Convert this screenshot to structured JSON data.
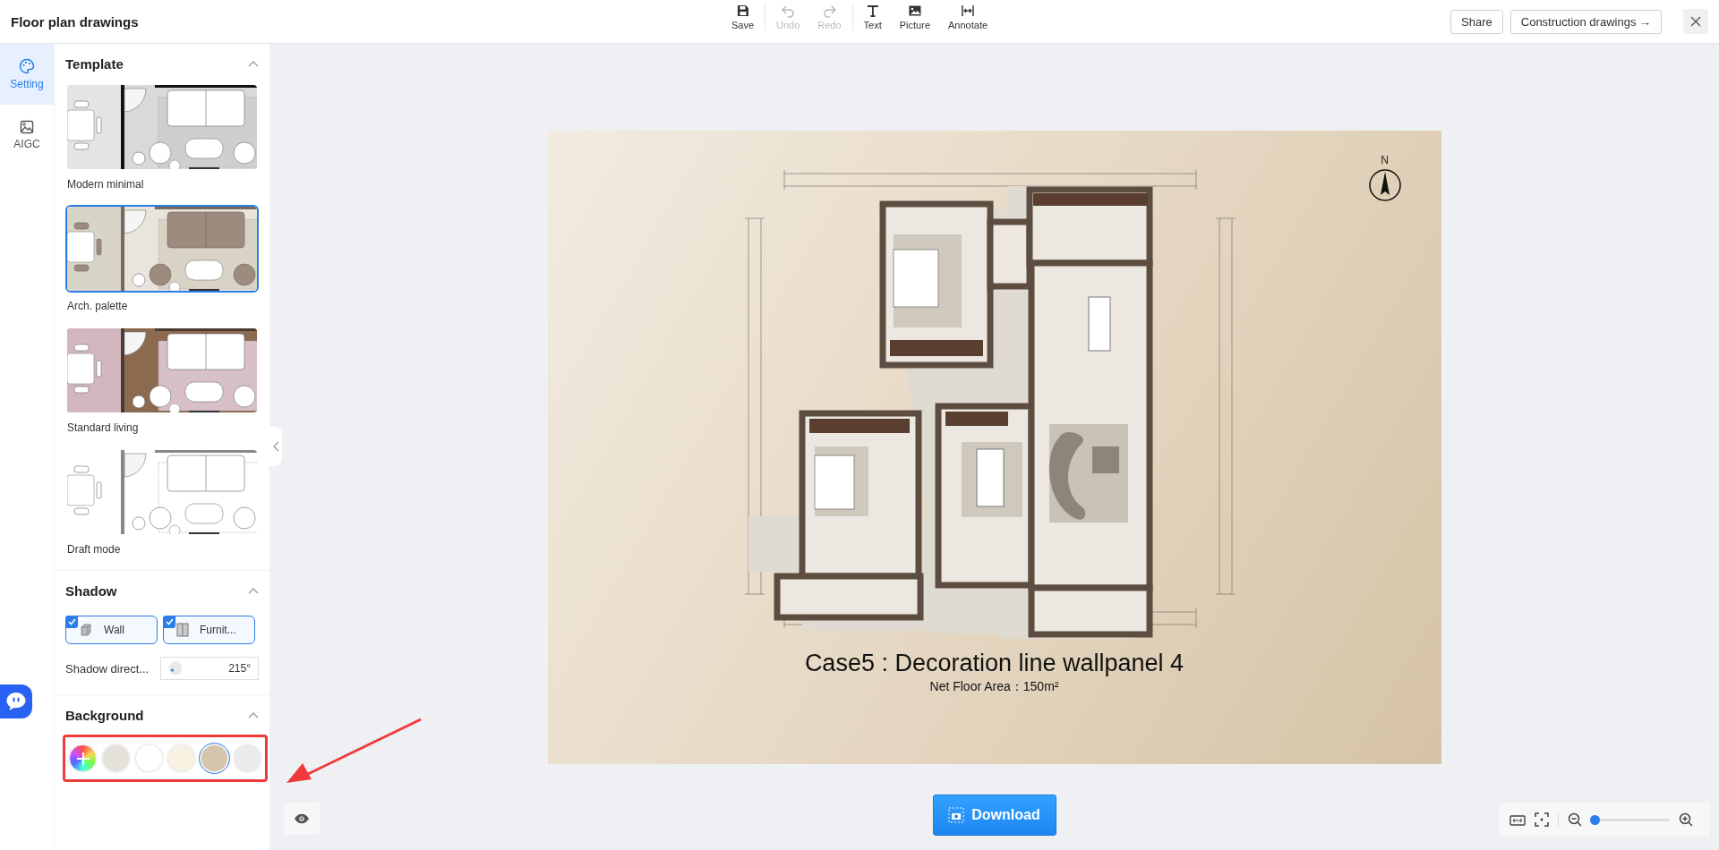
{
  "window": {
    "title": "Floor plan drawings"
  },
  "toolbar": [
    {
      "label": "Save",
      "kind": "save",
      "disabled": false
    },
    {
      "label": "Undo",
      "kind": "undo",
      "disabled": true
    },
    {
      "label": "Redo",
      "kind": "redo",
      "disabled": true
    },
    {
      "label": "Text",
      "kind": "text",
      "disabled": false
    },
    {
      "label": "Picture",
      "kind": "picture",
      "disabled": false
    },
    {
      "label": "Annotate",
      "kind": "annotate",
      "disabled": false
    }
  ],
  "header_actions": {
    "share": "Share",
    "construction": "Construction drawings →"
  },
  "rail": [
    {
      "label": "Setting",
      "kind": "palette",
      "selected": true
    },
    {
      "label": "AIGC",
      "kind": "image",
      "selected": false
    }
  ],
  "template": {
    "title": "Template",
    "expanded": true,
    "items": [
      {
        "label": "Modern minimal",
        "selected": false
      },
      {
        "label": "Arch. palette",
        "selected": true
      },
      {
        "label": "Standard living",
        "selected": false
      },
      {
        "label": "Draft mode",
        "selected": false
      }
    ]
  },
  "shadow": {
    "title": "Shadow",
    "expanded": true,
    "options": [
      {
        "label": "Wall",
        "kind": "wall",
        "checked": true
      },
      {
        "label": "Furnit...",
        "kind": "furniture",
        "checked": true
      }
    ],
    "direction_label": "Shadow direct...",
    "direction_value": "215°"
  },
  "background": {
    "title": "Background",
    "expanded": true,
    "swatches": [
      {
        "kind": "add",
        "selected": false
      },
      {
        "kind": "color",
        "color": "#e4e0da",
        "selected": false
      },
      {
        "kind": "color",
        "color": "#ffffff",
        "selected": false
      },
      {
        "kind": "color",
        "color": "#f7f1e2",
        "selected": false
      },
      {
        "kind": "color",
        "color": "#d6c5ab",
        "selected": true
      },
      {
        "kind": "color",
        "color": "#ebebeb",
        "selected": false
      }
    ]
  },
  "canvas": {
    "compass": "N",
    "title": "Case5 : Decoration line wallpanel 4",
    "subtitle": "Net Floor Area：150m²"
  },
  "download": "Download",
  "zoom": {
    "level": 0.04
  }
}
